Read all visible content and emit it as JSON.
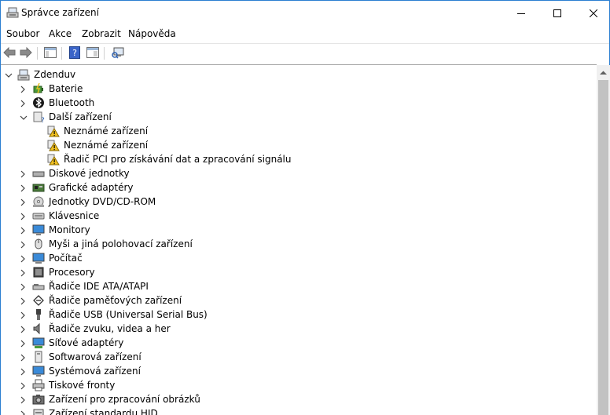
{
  "window": {
    "title": "Správce zařízení"
  },
  "menu": [
    "Soubor",
    "Akce",
    "Zobrazit",
    "Nápověda"
  ],
  "tree": {
    "root": "Zdenduv",
    "items": [
      {
        "label": "Baterie",
        "icon": "battery-icon",
        "expanded": false,
        "level": 1
      },
      {
        "label": "Bluetooth",
        "icon": "bluetooth-icon",
        "expanded": false,
        "level": 1
      },
      {
        "label": "Další zařízení",
        "icon": "other-devices-icon",
        "expanded": true,
        "level": 1
      },
      {
        "label": "Neznámé zařízení",
        "icon": "unknown-device-warning-icon",
        "level": 2
      },
      {
        "label": "Neznámé zařízení",
        "icon": "unknown-device-warning-icon",
        "level": 2
      },
      {
        "label": "Řadič PCI pro získávání dat a zpracování signálu",
        "icon": "unknown-device-warning-icon",
        "level": 2
      },
      {
        "label": "Diskové jednotky",
        "icon": "disk-drive-icon",
        "expanded": false,
        "level": 1
      },
      {
        "label": "Grafické adaptéry",
        "icon": "display-adapter-icon",
        "expanded": false,
        "level": 1
      },
      {
        "label": "Jednotky DVD/CD-ROM",
        "icon": "dvd-drive-icon",
        "expanded": false,
        "level": 1
      },
      {
        "label": "Klávesnice",
        "icon": "keyboard-icon",
        "expanded": false,
        "level": 1
      },
      {
        "label": "Monitory",
        "icon": "monitor-icon",
        "expanded": false,
        "level": 1
      },
      {
        "label": "Myši a jiná polohovací zařízení",
        "icon": "mouse-icon",
        "expanded": false,
        "level": 1
      },
      {
        "label": "Počítač",
        "icon": "computer-icon",
        "expanded": false,
        "level": 1
      },
      {
        "label": "Procesory",
        "icon": "processor-icon",
        "expanded": false,
        "level": 1
      },
      {
        "label": "Řadiče IDE ATA/ATAPI",
        "icon": "ide-controller-icon",
        "expanded": false,
        "level": 1
      },
      {
        "label": "Řadiče paměťových zařízení",
        "icon": "storage-controller-icon",
        "expanded": false,
        "level": 1
      },
      {
        "label": "Řadiče USB (Universal Serial Bus)",
        "icon": "usb-icon",
        "expanded": false,
        "level": 1
      },
      {
        "label": "Řadiče zvuku, videa a her",
        "icon": "speaker-icon",
        "expanded": false,
        "level": 1
      },
      {
        "label": "Síťové adaptéry",
        "icon": "network-adapter-icon",
        "expanded": false,
        "level": 1
      },
      {
        "label": "Softwarová zařízení",
        "icon": "software-device-icon",
        "expanded": false,
        "level": 1
      },
      {
        "label": "Systémová zařízení",
        "icon": "system-device-icon",
        "expanded": false,
        "level": 1
      },
      {
        "label": "Tiskové fronty",
        "icon": "printer-icon",
        "expanded": false,
        "level": 1
      },
      {
        "label": "Zařízení pro zpracování obrázků",
        "icon": "imaging-device-icon",
        "expanded": false,
        "level": 1
      },
      {
        "label": "Zařízení standardu HID",
        "icon": "hid-device-icon",
        "expanded": false,
        "level": 1
      }
    ]
  },
  "colors": {
    "accent": "#2b7fd1",
    "warning": "#f0c020",
    "scrollbar_thumb": "#c2c2c2"
  }
}
